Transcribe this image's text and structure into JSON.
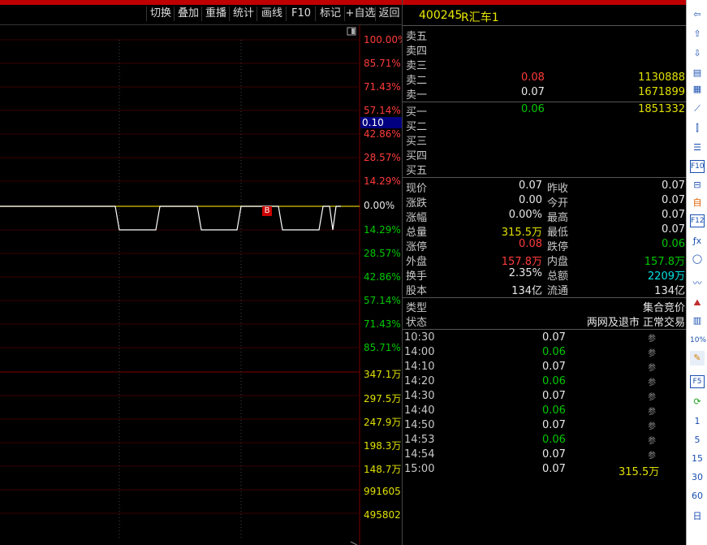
{
  "toolbar": {
    "buttons": [
      "切换",
      "叠加",
      "重播",
      "统计",
      "画线",
      "F10",
      "标记",
      "+自选",
      "返回"
    ]
  },
  "chart": {
    "price_labels": [
      {
        "text": "100.00%",
        "cls": "red"
      },
      {
        "text": "85.71%",
        "cls": "red"
      },
      {
        "text": "71.43%",
        "cls": "red"
      },
      {
        "text": "57.14%",
        "cls": "red"
      },
      {
        "text": "42.86%",
        "cls": "red"
      },
      {
        "text": "28.57%",
        "cls": "red"
      },
      {
        "text": "14.29%",
        "cls": "red"
      },
      {
        "text": "0.00%",
        "cls": "white"
      },
      {
        "text": "14.29%",
        "cls": "green"
      },
      {
        "text": "28.57%",
        "cls": "green"
      },
      {
        "text": "42.86%",
        "cls": "green"
      },
      {
        "text": "57.14%",
        "cls": "green"
      },
      {
        "text": "71.43%",
        "cls": "green"
      },
      {
        "text": "85.71%",
        "cls": "green"
      }
    ],
    "volume_labels": [
      "347.1万",
      "297.5万",
      "247.9万",
      "198.3万",
      "148.7万",
      "991605",
      "495802"
    ],
    "cursor_price": "0.10",
    "marker": "B"
  },
  "panel": {
    "title_code": "400245",
    "title_name": "R汇车1",
    "asks": [
      {
        "label": "卖五",
        "price": "",
        "vol": ""
      },
      {
        "label": "卖四",
        "price": "",
        "vol": ""
      },
      {
        "label": "卖三",
        "price": "",
        "vol": ""
      },
      {
        "label": "卖二",
        "price": "0.08",
        "vol": "1130888"
      },
      {
        "label": "卖一",
        "price": "0.07",
        "vol": "1671899"
      }
    ],
    "bids": [
      {
        "label": "买一",
        "price": "0.06",
        "vol": "1851332"
      },
      {
        "label": "买二",
        "price": "",
        "vol": ""
      },
      {
        "label": "买三",
        "price": "",
        "vol": ""
      },
      {
        "label": "买四",
        "price": "",
        "vol": ""
      },
      {
        "label": "买五",
        "price": "",
        "vol": ""
      }
    ],
    "stats": [
      {
        "l1": "现价",
        "v1": "0.07",
        "c1": "white",
        "l2": "昨收",
        "v2": "0.07",
        "c2": "white"
      },
      {
        "l1": "涨跌",
        "v1": "0.00",
        "c1": "white",
        "l2": "今开",
        "v2": "0.07",
        "c2": "white"
      },
      {
        "l1": "涨幅",
        "v1": "0.00%",
        "c1": "white",
        "l2": "最高",
        "v2": "0.07",
        "c2": "white"
      },
      {
        "l1": "总量",
        "v1": "315.5万",
        "c1": "yellow",
        "l2": "最低",
        "v2": "0.07",
        "c2": "white"
      },
      {
        "l1": "涨停",
        "v1": "0.08",
        "c1": "red",
        "l2": "跌停",
        "v2": "0.06",
        "c2": "green"
      },
      {
        "l1": "外盘",
        "v1": "157.8万",
        "c1": "red",
        "l2": "内盘",
        "v2": "157.8万",
        "c2": "green"
      },
      {
        "l1": "换手",
        "v1": "2.35%",
        "c1": "white",
        "l2": "总额",
        "v2": "2209万",
        "c2": "cyan"
      },
      {
        "l1": "股本",
        "v1": "134亿",
        "c1": "white",
        "l2": "流通",
        "v2": "134亿",
        "c2": "white"
      }
    ],
    "type_label": "类型",
    "type_value": "集合竞价",
    "status_label": "状态",
    "status_value": "两网及退市 正常交易",
    "trades": [
      {
        "time": "10:30",
        "price": "0.07",
        "pc": "white",
        "vol": "",
        "flag": "参"
      },
      {
        "time": "14:00",
        "price": "0.06",
        "pc": "green",
        "vol": "",
        "flag": "参"
      },
      {
        "time": "14:10",
        "price": "0.07",
        "pc": "white",
        "vol": "",
        "flag": "参"
      },
      {
        "time": "14:20",
        "price": "0.06",
        "pc": "green",
        "vol": "",
        "flag": "参"
      },
      {
        "time": "14:30",
        "price": "0.07",
        "pc": "white",
        "vol": "",
        "flag": "参"
      },
      {
        "time": "14:40",
        "price": "0.06",
        "pc": "green",
        "vol": "",
        "flag": "参"
      },
      {
        "time": "14:50",
        "price": "0.07",
        "pc": "white",
        "vol": "",
        "flag": "参"
      },
      {
        "time": "14:53",
        "price": "0.06",
        "pc": "green",
        "vol": "",
        "flag": "参"
      },
      {
        "time": "14:54",
        "price": "0.07",
        "pc": "white",
        "vol": "",
        "flag": "参"
      },
      {
        "time": "15:00",
        "price": "0.07",
        "pc": "white",
        "vol": "315.5万",
        "flag": ""
      }
    ]
  },
  "sidebar": {
    "icons": [
      "back-icon",
      "up-arrow-icon",
      "down-arrow-icon",
      "report-icon",
      "grid-icon",
      "line-chart-icon",
      "candle-chart-icon",
      "list-icon",
      "f10-icon",
      "f11-icon",
      "self-icon",
      "f12-icon",
      "formula-icon",
      "circle-icon",
      "wave-icon",
      "mountain-icon",
      "table-icon",
      "percent-icon",
      "pencil-icon",
      "f5-icon",
      "refresh-icon"
    ],
    "icon_texts": [
      "⇦",
      "⇧",
      "⇩",
      "▤",
      "▦",
      "⟋",
      "⫿",
      "☰",
      "F10",
      "⊟",
      "自",
      "F12",
      "ƒx",
      "◯",
      "〰",
      "⛰",
      "▥",
      "10%",
      "✎",
      "F5",
      "⟳"
    ],
    "periods": [
      "1",
      "5",
      "15",
      "30",
      "60",
      "日"
    ]
  }
}
